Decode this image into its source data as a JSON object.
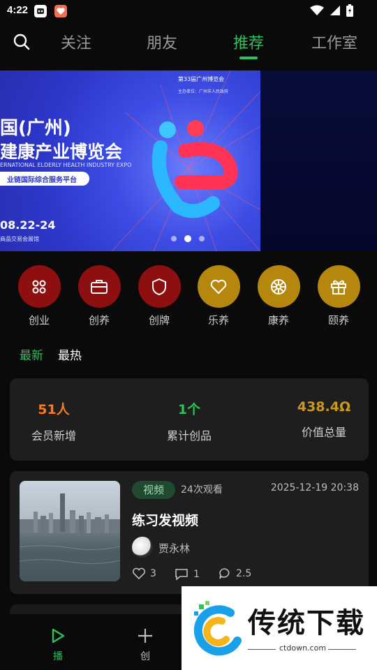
{
  "status_bar": {
    "time": "4:22"
  },
  "top_nav": {
    "tabs": [
      {
        "label": "关注"
      },
      {
        "label": "朋友"
      },
      {
        "label": "推荐"
      },
      {
        "label": "工作室"
      }
    ],
    "active_tab": "推荐"
  },
  "banner": {
    "badge": "第33届广州博览会",
    "sub_badge": "主办单位：广州市人民政府",
    "headline_1": "国(广州)",
    "headline_2": "建康产业博览会",
    "headline_en": "ERNATIONAL ELDERLY HEALTH INDUSTRY EXPO",
    "pill_text": "业链国际综合服务平台",
    "date": "08.22-24",
    "venue": "商品交易会展馆",
    "pages": 3,
    "current_page": 2
  },
  "categories": [
    {
      "label": "创业",
      "icon": "grid-icon",
      "color": "#8e0f0f"
    },
    {
      "label": "创养",
      "icon": "briefcase-icon",
      "color": "#8e0f0f"
    },
    {
      "label": "创牌",
      "icon": "shield-icon",
      "color": "#8e0f0f"
    },
    {
      "label": "乐养",
      "icon": "heart-icon",
      "color": "#b5870d"
    },
    {
      "label": "康养",
      "icon": "flower-icon",
      "color": "#b5870d"
    },
    {
      "label": "颐养",
      "icon": "gift-icon",
      "color": "#b5870d"
    }
  ],
  "sub_tabs": {
    "latest": "最新",
    "hottest": "最热"
  },
  "stats": [
    {
      "value": "51人",
      "label": "会员新增",
      "color": "#ff7a1a"
    },
    {
      "value": "1个",
      "label": "累计创品",
      "color": "#2fc15a"
    },
    {
      "value": "438.4Ω",
      "label": "价值总量",
      "color": "#c99a1e"
    }
  ],
  "video": {
    "tag": "视频",
    "views": "24次观看",
    "date": "2025-12-19 20:38",
    "title": "练习发视频",
    "author": "贾永林",
    "likes": "3",
    "comments": "1",
    "shares": "2.5"
  },
  "bottom_nav": [
    {
      "label": "播",
      "icon": "play-icon",
      "active": true
    },
    {
      "label": "创",
      "icon": "plus-icon",
      "active": false
    }
  ],
  "watermark": {
    "text": "传统下载",
    "url": "ctdown.com"
  },
  "colors": {
    "accent": "#2fc15a",
    "background": "#0a0a0a",
    "card": "#1e1e1e"
  }
}
